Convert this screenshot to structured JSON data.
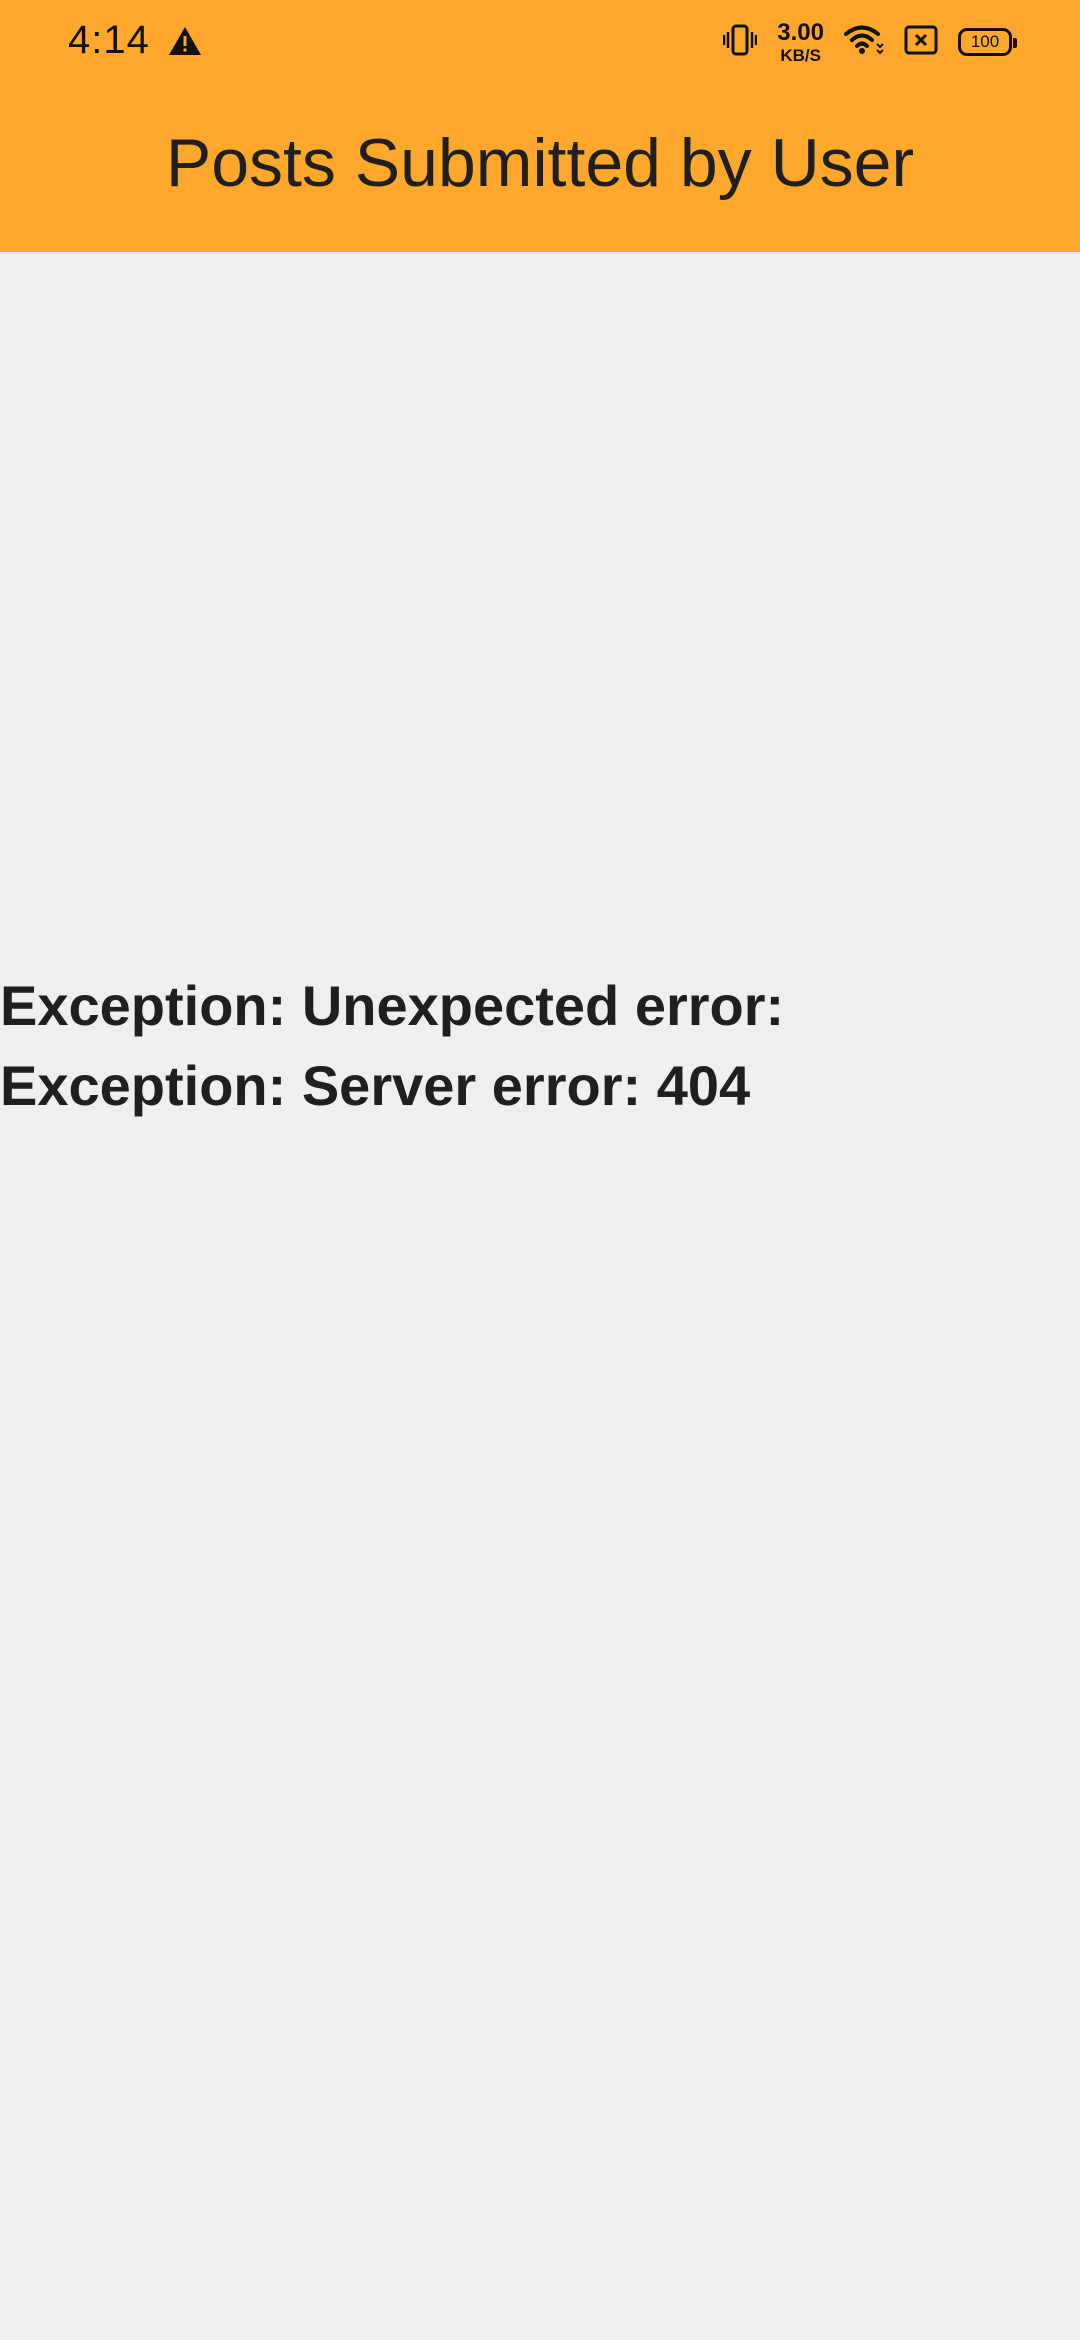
{
  "status_bar": {
    "time": "4:14",
    "net_speed_value": "3.00",
    "net_speed_unit": "KB/S",
    "battery_level": "100",
    "icons": [
      "warning-icon",
      "vibrate-icon",
      "wifi-icon",
      "sim-off-icon",
      "battery-icon"
    ]
  },
  "app_bar": {
    "title": "Posts Submitted by User",
    "background_color": "#ffa82b"
  },
  "content": {
    "error_message": "Exception: Unexpected error: Exception: Server error: 404",
    "background_color": "#efefef"
  }
}
